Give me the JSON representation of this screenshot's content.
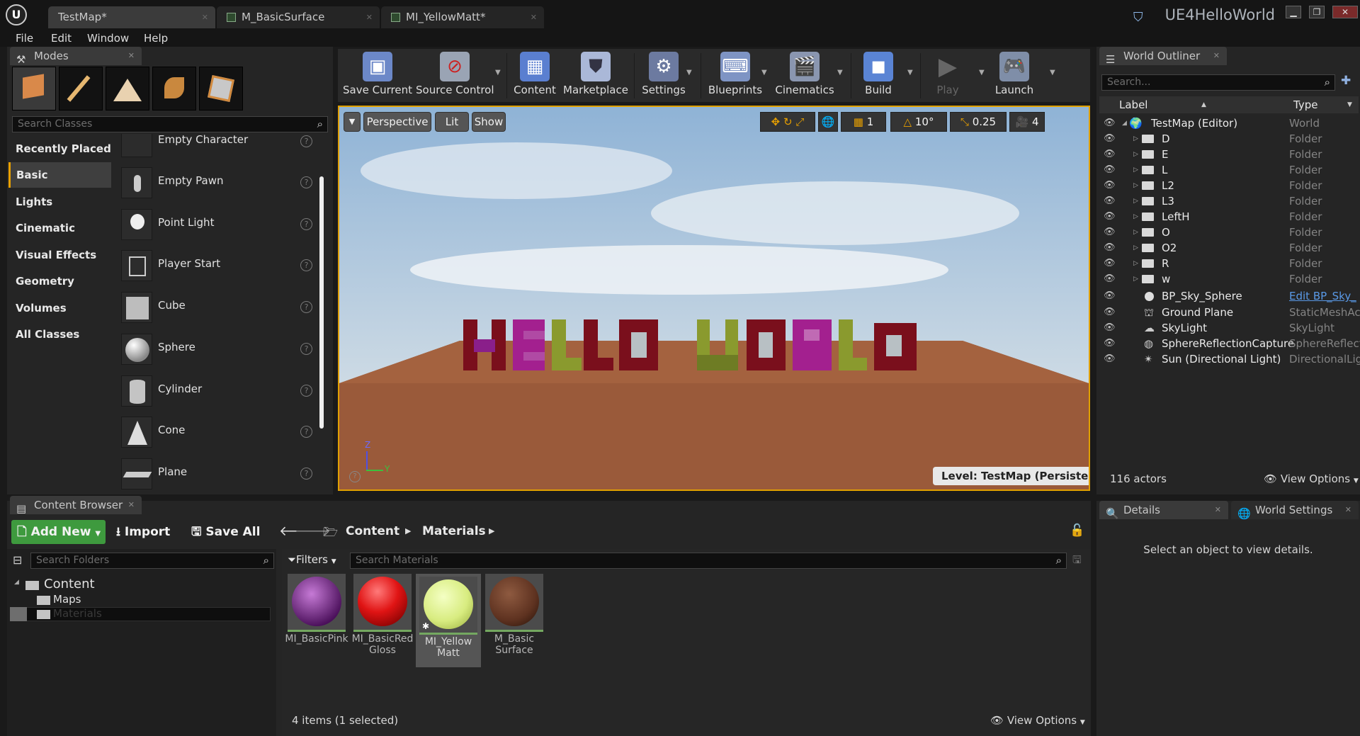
{
  "titlebar": {
    "logo": "U",
    "tabs": [
      {
        "label": "TestMap*",
        "active": true
      },
      {
        "label": "M_BasicSurface",
        "active": false
      },
      {
        "label": "MI_YellowMatt*",
        "active": false
      }
    ],
    "app_name": "UE4HelloWorld"
  },
  "menu": [
    "File",
    "Edit",
    "Window",
    "Help"
  ],
  "modes": {
    "tab_label": "Modes",
    "search_placeholder": "Search Classes",
    "categories": [
      "Recently Placed",
      "Basic",
      "Lights",
      "Cinematic",
      "Visual Effects",
      "Geometry",
      "Volumes",
      "All Classes"
    ],
    "selected_category": "Basic",
    "items": [
      "Empty Character",
      "Empty Pawn",
      "Point Light",
      "Player Start",
      "Cube",
      "Sphere",
      "Cylinder",
      "Cone",
      "Plane"
    ],
    "help_glyph": "?"
  },
  "toolbar": {
    "buttons": [
      {
        "label": "Save Current",
        "icon": "save-icon"
      },
      {
        "label": "Source Control",
        "icon": "source-control-icon"
      },
      {
        "label": "Content",
        "icon": "content-icon"
      },
      {
        "label": "Marketplace",
        "icon": "marketplace-icon"
      },
      {
        "label": "Settings",
        "icon": "settings-icon"
      },
      {
        "label": "Blueprints",
        "icon": "blueprints-icon"
      },
      {
        "label": "Cinematics",
        "icon": "cinematics-icon"
      },
      {
        "label": "Build",
        "icon": "build-icon"
      },
      {
        "label": "Play",
        "icon": "play-icon"
      },
      {
        "label": "Launch",
        "icon": "launch-icon"
      }
    ]
  },
  "viewport": {
    "perspective": "Perspective",
    "lit": "Lit",
    "show": "Show",
    "grid_snap": "1",
    "rotation_snap": "10°",
    "scale_snap": "0.25",
    "camera_speed": "4",
    "level_label": "Level:  TestMap (Persistent)",
    "axis_z": "Z",
    "axis_y": "Y",
    "scene_text": "HELLO WORLD",
    "colors": {
      "sky_top": "#8fb3d6",
      "sky_bottom": "#d6e2ea",
      "ground": "#9a5a3a",
      "letter_red": "#7a0f1c",
      "letter_green": "#8a9a2e",
      "letter_pink": "#a3208f"
    }
  },
  "outliner": {
    "tab_label": "World Outliner",
    "search_placeholder": "Search...",
    "col_label": "Label",
    "col_type": "Type",
    "rows": [
      {
        "label": "TestMap (Editor)",
        "type": "World",
        "kind": "world"
      },
      {
        "label": "D",
        "type": "Folder",
        "kind": "folder"
      },
      {
        "label": "E",
        "type": "Folder",
        "kind": "folder"
      },
      {
        "label": "L",
        "type": "Folder",
        "kind": "folder"
      },
      {
        "label": "L2",
        "type": "Folder",
        "kind": "folder"
      },
      {
        "label": "L3",
        "type": "Folder",
        "kind": "folder"
      },
      {
        "label": "LeftH",
        "type": "Folder",
        "kind": "folder"
      },
      {
        "label": "O",
        "type": "Folder",
        "kind": "folder"
      },
      {
        "label": "O2",
        "type": "Folder",
        "kind": "folder"
      },
      {
        "label": "R",
        "type": "Folder",
        "kind": "folder"
      },
      {
        "label": "w",
        "type": "Folder",
        "kind": "folder"
      },
      {
        "label": "BP_Sky_Sphere",
        "type": "Edit BP_Sky_",
        "kind": "actor"
      },
      {
        "label": "Ground Plane",
        "type": "StaticMeshAc",
        "kind": "actor"
      },
      {
        "label": "SkyLight",
        "type": "SkyLight",
        "kind": "actor"
      },
      {
        "label": "SphereReflectionCapture",
        "type": "SphereReflecti",
        "kind": "actor"
      },
      {
        "label": "Sun (Directional Light)",
        "type": "DirectionalLig",
        "kind": "actor"
      }
    ],
    "actor_count": "116 actors",
    "view_options": "View Options"
  },
  "details": {
    "tab_details": "Details",
    "tab_world_settings": "World Settings",
    "empty_message": "Select an object to view details."
  },
  "content_browser": {
    "tab_label": "Content Browser",
    "add_new": "Add New",
    "import": "Import",
    "save_all": "Save All",
    "breadcrumb": [
      "Content",
      "Materials"
    ],
    "search_folders_placeholder": "Search Folders",
    "folders": [
      {
        "name": "Content",
        "level": 0
      },
      {
        "name": "Maps",
        "level": 1
      },
      {
        "name": "Materials",
        "level": 1,
        "selected": true
      }
    ],
    "filters": "Filters",
    "search_assets_placeholder": "Search Materials",
    "assets": [
      {
        "name": "MI_BasicPink",
        "color": "#7a1a8a",
        "selected": false
      },
      {
        "name": "MI_BasicRed\nGloss",
        "color": "#e01414",
        "selected": false
      },
      {
        "name": "MI_Yellow\nMatt",
        "color": "#d8ec80",
        "selected": true
      },
      {
        "name": "M_Basic\nSurface",
        "color": "#5e3220",
        "selected": false
      }
    ],
    "status": "4 items (1 selected)",
    "view_options": "View Options"
  }
}
